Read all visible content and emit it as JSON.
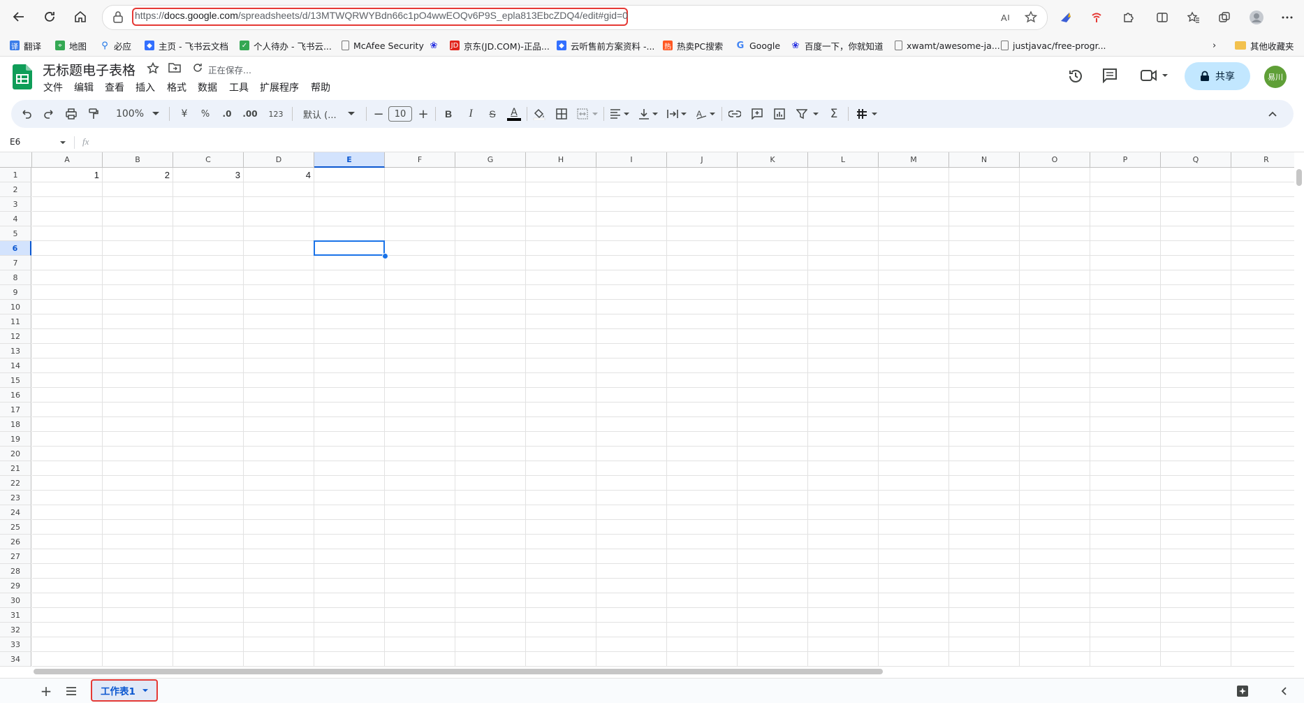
{
  "browser": {
    "url_prefix": "https://",
    "url_host": "docs.google.com",
    "url_path": "/spreadsheets/d/13MTWQRWYBdn66c1pO4wwEOQv6P9S_epla813EbcZDQ4/edit#gid=0"
  },
  "bookmarks": [
    {
      "label": "翻译",
      "icon": "translate-icon",
      "color": "#3b7de9"
    },
    {
      "label": "地图",
      "icon": "map-icon",
      "color": "#34a853"
    },
    {
      "label": "必应",
      "icon": "search-icon",
      "color": "#1a73e8"
    },
    {
      "label": "主页 - 飞书云文档",
      "icon": "feishu-icon",
      "color": "#3370ff"
    },
    {
      "label": "个人待办 - 飞书云...",
      "icon": "todo-icon",
      "color": "#34a853"
    },
    {
      "label": "McAfee Security",
      "icon": "page-icon",
      "color": "#777777"
    },
    {
      "label": "",
      "icon": "baidu-icon",
      "color": "#2932e1"
    },
    {
      "label": "京东(JD.COM)-正品...",
      "icon": "jd-icon",
      "color": "#e1251b"
    },
    {
      "label": "云听售前方案资料 -...",
      "icon": "feishu-icon",
      "color": "#3370ff"
    },
    {
      "label": "热卖PC搜索",
      "icon": "hot-icon",
      "color": "#ff5722"
    },
    {
      "label": "Google",
      "icon": "google-icon",
      "color": "#4285f4"
    },
    {
      "label": "百度一下，你就知道",
      "icon": "baidu-icon",
      "color": "#2932e1"
    },
    {
      "label": "xwamt/awesome-ja...",
      "icon": "page-icon",
      "color": "#777777"
    },
    {
      "label": "justjavac/free-progr...",
      "icon": "page-icon",
      "color": "#777777"
    }
  ],
  "other_bookmarks": "其他收藏夹",
  "doc": {
    "title": "无标题电子表格",
    "saving_status": "正在保存...",
    "share_label": "共享",
    "avatar_text": "易川"
  },
  "menu": [
    "文件",
    "编辑",
    "查看",
    "插入",
    "格式",
    "数据",
    "工具",
    "扩展程序",
    "帮助"
  ],
  "toolbar": {
    "zoom": "100%",
    "currency": "¥",
    "percent": "%",
    "dec_less": ".0",
    "dec_more": ".00",
    "number_format": "123",
    "font": "默认 (...",
    "font_size": "10",
    "bold": "B",
    "italic": "I",
    "strike": "S",
    "text_color_label": "A"
  },
  "name_box": "E6",
  "fx": "fx",
  "columns": [
    "A",
    "B",
    "C",
    "D",
    "E",
    "F",
    "G",
    "H",
    "I",
    "J",
    "K",
    "L",
    "M",
    "N",
    "O",
    "P",
    "Q",
    "R"
  ],
  "rows": [
    "1",
    "2",
    "3",
    "4",
    "5",
    "6",
    "7",
    "8",
    "9",
    "10",
    "11",
    "12",
    "13",
    "14",
    "15",
    "16",
    "17",
    "18",
    "19",
    "20",
    "21",
    "22",
    "23",
    "24",
    "25",
    "26",
    "27",
    "28",
    "29",
    "30",
    "31",
    "32",
    "33",
    "34"
  ],
  "selected_cell": {
    "col": "E",
    "row": "6"
  },
  "cells": [
    {
      "col": "A",
      "row": "1",
      "value": "1"
    },
    {
      "col": "B",
      "row": "1",
      "value": "2"
    },
    {
      "col": "C",
      "row": "1",
      "value": "3"
    },
    {
      "col": "D",
      "row": "1",
      "value": "4"
    }
  ],
  "sheet_tab": "工作表1",
  "colors": {
    "accent": "#1a73e8",
    "highlight_red": "#e53935",
    "share_bg": "#c2e7ff",
    "selected_header": "#d3e3fd"
  }
}
